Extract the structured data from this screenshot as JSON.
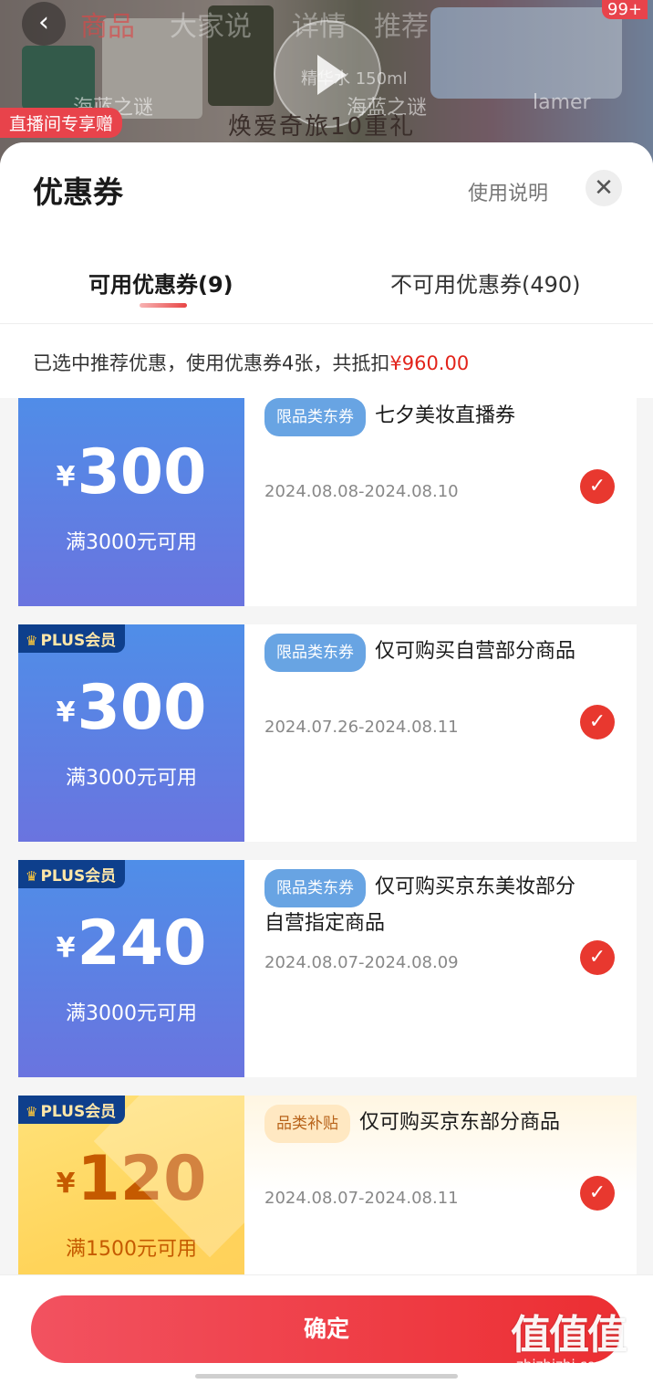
{
  "background": {
    "back_icon": "‹",
    "tabs": [
      "商品",
      "大家说",
      "详情",
      "推荐"
    ],
    "product_captions": [
      "海蓝之谜",
      "海蓝之谜",
      "lamer"
    ],
    "live_tag": "直播间专享赠",
    "slogan": "焕爱奇旅10重礼",
    "cart_badge": "99+",
    "water_label": "精华水 150ml"
  },
  "sheet": {
    "title": "优惠券",
    "help_link": "使用说明",
    "close_icon": "✕",
    "tabs": {
      "available": "可用优惠券(9)",
      "unavailable": "不可用优惠券(490)"
    },
    "summary_prefix": "已选中推荐优惠，使用优惠券4张，共抵扣",
    "summary_amount": "¥960.00"
  },
  "coupons": [
    {
      "plus_badge": "",
      "currency": "¥",
      "amount": "300",
      "condition": "满3000元可用",
      "tag": "限品类东券",
      "description": "七夕美妆直播券",
      "validity": "2024.08.08-2024.08.10",
      "selected": true
    },
    {
      "plus_badge": "PLUS会员",
      "currency": "¥",
      "amount": "300",
      "condition": "满3000元可用",
      "tag": "限品类东券",
      "description": "仅可购买自营部分商品",
      "validity": "2024.07.26-2024.08.11",
      "selected": true
    },
    {
      "plus_badge": "PLUS会员",
      "currency": "¥",
      "amount": "240",
      "condition": "满3000元可用",
      "tag": "限品类东券",
      "description": "仅可购买京东美妆部分自营指定商品",
      "validity": "2024.08.07-2024.08.09",
      "selected": true
    },
    {
      "plus_badge": "PLUS会员",
      "currency": "¥",
      "amount": "120",
      "condition": "满1500元可用",
      "tag": "品类补贴",
      "description": "仅可购买京东部分商品",
      "validity": "2024.08.07-2024.08.11",
      "selected": true
    }
  ],
  "footer": {
    "confirm_label": "确定"
  },
  "watermark": {
    "logo": "值值值",
    "url": "zhizhizhi.com"
  },
  "colors": {
    "accent_red": "#e2231a",
    "coupon_blue": "#4f8ee8",
    "coupon_gold": "#ffd45a",
    "plus_navy": "#0e3f8c"
  }
}
